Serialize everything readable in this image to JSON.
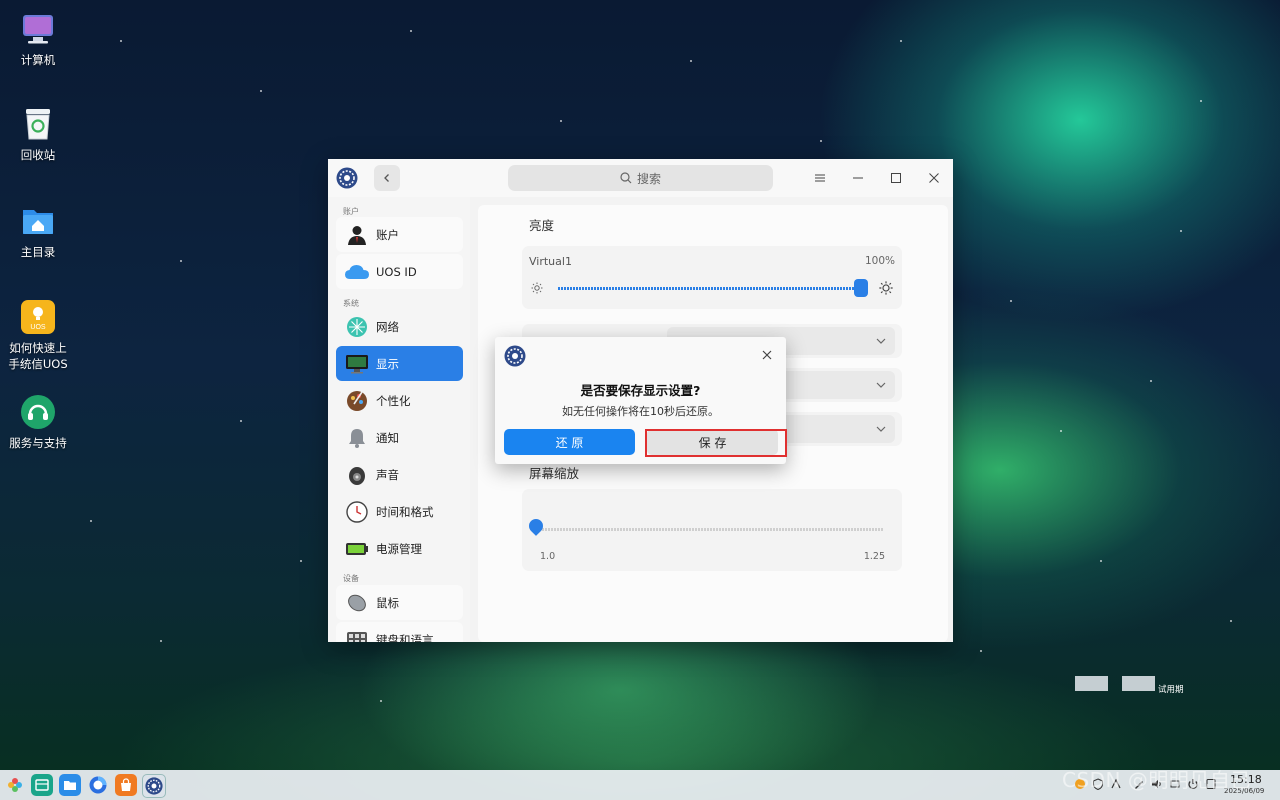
{
  "desktop": {
    "icons": [
      {
        "label": "计算机",
        "icon": "computer-icon"
      },
      {
        "label": "回收站",
        "icon": "trash-icon"
      },
      {
        "label": "主目录",
        "icon": "home-folder-icon"
      },
      {
        "label": "如何快速上手统信UOS",
        "line1": "如何快速上",
        "line2": "手统信UOS",
        "badge": "UOS",
        "icon": "guide-icon"
      },
      {
        "label": "服务与支持",
        "icon": "support-icon"
      }
    ],
    "trial_label": "试用期",
    "watermark": "CSDN @明明见自己"
  },
  "window": {
    "search_placeholder": "搜索",
    "sidebar": {
      "sections": {
        "accounts": "账户",
        "system": "系统",
        "devices": "设备"
      },
      "items": [
        {
          "label": "账户",
          "icon": "user-icon"
        },
        {
          "label": "UOS ID",
          "icon": "cloud-icon"
        },
        {
          "label": "网络",
          "icon": "network-icon"
        },
        {
          "label": "显示",
          "icon": "display-icon",
          "active": true
        },
        {
          "label": "个性化",
          "icon": "palette-icon"
        },
        {
          "label": "通知",
          "icon": "bell-icon"
        },
        {
          "label": "声音",
          "icon": "speaker-icon"
        },
        {
          "label": "时间和格式",
          "icon": "clock-icon"
        },
        {
          "label": "电源管理",
          "icon": "battery-icon"
        },
        {
          "label": "鼠标",
          "icon": "mouse-icon"
        },
        {
          "label": "键盘和语言",
          "icon": "keyboard-icon"
        }
      ]
    },
    "display": {
      "brightness_title": "亮度",
      "monitor_name": "Virtual1",
      "brightness_value": "100%",
      "brightness_level": 1.0,
      "scale_title": "屏幕缩放",
      "scale_min": "1.0",
      "scale_max": "1.25",
      "scale_level": 0.0
    }
  },
  "dialog": {
    "title": "是否要保存显示设置?",
    "message": "如无任何操作将在10秒后还原。",
    "revert_button": "还 原",
    "save_button": "保 存"
  },
  "taskbar": {
    "time": "15:18",
    "date": "2025/06/09"
  },
  "colors": {
    "accent": "#2a7fe6",
    "primary_button": "#1a84f0",
    "highlight_border": "#e03030"
  }
}
